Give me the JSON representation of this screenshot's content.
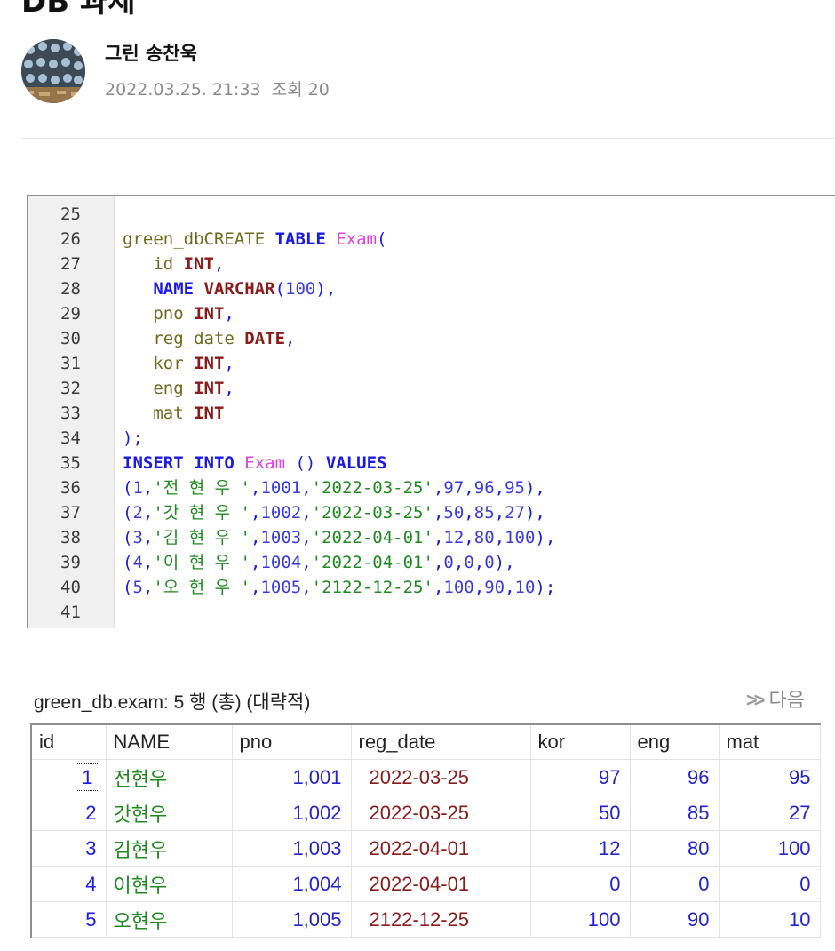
{
  "post": {
    "title": "DB 과제",
    "author": "그린 송찬욱",
    "date": "2022.03.25. 21:33",
    "views": "조회 20"
  },
  "code_lines": [
    {
      "n": "25",
      "tokens": []
    },
    {
      "n": "26",
      "tokens": [
        [
          "id",
          "green_dbCREATE "
        ],
        [
          "kw",
          "TABLE "
        ],
        [
          "tb",
          "Exam"
        ],
        [
          "pu",
          "("
        ]
      ]
    },
    {
      "n": "27",
      "tokens": [
        [
          "id",
          "   id "
        ],
        [
          "ty",
          "INT"
        ],
        [
          "pu",
          ","
        ]
      ]
    },
    {
      "n": "28",
      "tokens": [
        [
          "kw",
          "   NAME "
        ],
        [
          "ty",
          "VARCHAR"
        ],
        [
          "pu",
          "("
        ],
        [
          "nu",
          "100"
        ],
        [
          "pu",
          "),"
        ]
      ]
    },
    {
      "n": "29",
      "tokens": [
        [
          "id",
          "   pno "
        ],
        [
          "ty",
          "INT"
        ],
        [
          "pu",
          ","
        ]
      ]
    },
    {
      "n": "30",
      "tokens": [
        [
          "id",
          "   reg_date "
        ],
        [
          "ty",
          "DATE"
        ],
        [
          "pu",
          ","
        ]
      ]
    },
    {
      "n": "31",
      "tokens": [
        [
          "id",
          "   kor "
        ],
        [
          "ty",
          "INT"
        ],
        [
          "pu",
          ","
        ]
      ]
    },
    {
      "n": "32",
      "tokens": [
        [
          "id",
          "   eng "
        ],
        [
          "ty",
          "INT"
        ],
        [
          "pu",
          ","
        ]
      ]
    },
    {
      "n": "33",
      "tokens": [
        [
          "id",
          "   mat "
        ],
        [
          "ty",
          "INT"
        ]
      ]
    },
    {
      "n": "34",
      "tokens": [
        [
          "pu",
          ");"
        ]
      ]
    },
    {
      "n": "35",
      "tokens": [
        [
          "kw",
          "INSERT "
        ],
        [
          "kw",
          "INTO "
        ],
        [
          "tb",
          "Exam "
        ],
        [
          "pu",
          "() "
        ],
        [
          "kw",
          "VALUES"
        ]
      ]
    },
    {
      "n": "36",
      "tokens": [
        [
          "pu",
          "("
        ],
        [
          "nu",
          "1"
        ],
        [
          "pu",
          ","
        ],
        [
          "st",
          "'전 현 우 '"
        ],
        [
          "pu",
          ","
        ],
        [
          "nu",
          "1001"
        ],
        [
          "pu",
          ","
        ],
        [
          "st",
          "'2022-03-25'"
        ],
        [
          "pu",
          ","
        ],
        [
          "nu",
          "97"
        ],
        [
          "pu",
          ","
        ],
        [
          "nu",
          "96"
        ],
        [
          "pu",
          ","
        ],
        [
          "nu",
          "95"
        ],
        [
          "pu",
          "),"
        ]
      ]
    },
    {
      "n": "37",
      "tokens": [
        [
          "pu",
          "("
        ],
        [
          "nu",
          "2"
        ],
        [
          "pu",
          ","
        ],
        [
          "st",
          "'갓 현 우 '"
        ],
        [
          "pu",
          ","
        ],
        [
          "nu",
          "1002"
        ],
        [
          "pu",
          ","
        ],
        [
          "st",
          "'2022-03-25'"
        ],
        [
          "pu",
          ","
        ],
        [
          "nu",
          "50"
        ],
        [
          "pu",
          ","
        ],
        [
          "nu",
          "85"
        ],
        [
          "pu",
          ","
        ],
        [
          "nu",
          "27"
        ],
        [
          "pu",
          "),"
        ]
      ]
    },
    {
      "n": "38",
      "tokens": [
        [
          "pu",
          "("
        ],
        [
          "nu",
          "3"
        ],
        [
          "pu",
          ","
        ],
        [
          "st",
          "'김 현 우 '"
        ],
        [
          "pu",
          ","
        ],
        [
          "nu",
          "1003"
        ],
        [
          "pu",
          ","
        ],
        [
          "st",
          "'2022-04-01'"
        ],
        [
          "pu",
          ","
        ],
        [
          "nu",
          "12"
        ],
        [
          "pu",
          ","
        ],
        [
          "nu",
          "80"
        ],
        [
          "pu",
          ","
        ],
        [
          "nu",
          "100"
        ],
        [
          "pu",
          "),"
        ]
      ]
    },
    {
      "n": "39",
      "tokens": [
        [
          "pu",
          "("
        ],
        [
          "nu",
          "4"
        ],
        [
          "pu",
          ","
        ],
        [
          "st",
          "'이 현 우 '"
        ],
        [
          "pu",
          ","
        ],
        [
          "nu",
          "1004"
        ],
        [
          "pu",
          ","
        ],
        [
          "st",
          "'2022-04-01'"
        ],
        [
          "pu",
          ","
        ],
        [
          "nu",
          "0"
        ],
        [
          "pu",
          ","
        ],
        [
          "nu",
          "0"
        ],
        [
          "pu",
          ","
        ],
        [
          "nu",
          "0"
        ],
        [
          "pu",
          "),"
        ]
      ]
    },
    {
      "n": "40",
      "tokens": [
        [
          "pu",
          "("
        ],
        [
          "nu",
          "5"
        ],
        [
          "pu",
          ","
        ],
        [
          "st",
          "'오 현 우 '"
        ],
        [
          "pu",
          ","
        ],
        [
          "nu",
          "1005"
        ],
        [
          "pu",
          ","
        ],
        [
          "st",
          "'2122-12-25'"
        ],
        [
          "pu",
          ","
        ],
        [
          "nu",
          "100"
        ],
        [
          "pu",
          ","
        ],
        [
          "nu",
          "90"
        ],
        [
          "pu",
          ","
        ],
        [
          "nu",
          "10"
        ],
        [
          "pu",
          ");"
        ]
      ]
    },
    {
      "n": "41",
      "tokens": []
    }
  ],
  "result": {
    "heading": "green_db.exam: 5 행 (총) (대략적)",
    "next_label": "다음",
    "columns": [
      "id",
      "NAME",
      "pno",
      "reg_date",
      "kor",
      "eng",
      "mat"
    ],
    "rows": [
      [
        "1",
        "전현우",
        "1,001",
        "2022-03-25",
        "97",
        "96",
        "95"
      ],
      [
        "2",
        "갓현우",
        "1,002",
        "2022-03-25",
        "50",
        "85",
        "27"
      ],
      [
        "3",
        "김현우",
        "1,003",
        "2022-04-01",
        "12",
        "80",
        "100"
      ],
      [
        "4",
        "이현우",
        "1,004",
        "2022-04-01",
        "0",
        "0",
        "0"
      ],
      [
        "5",
        "오현우",
        "1,005",
        "2122-12-25",
        "100",
        "90",
        "10"
      ]
    ]
  }
}
